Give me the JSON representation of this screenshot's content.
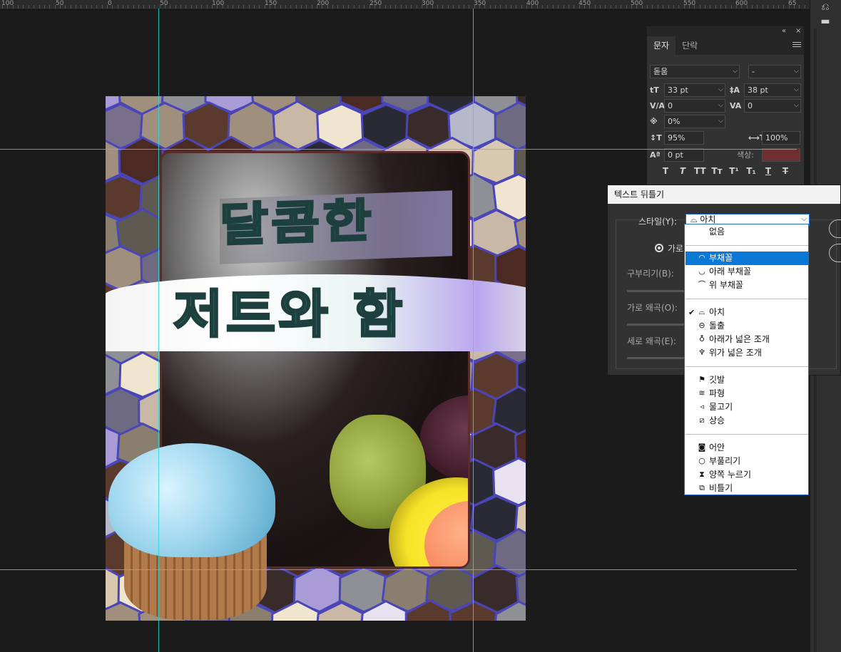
{
  "ruler": {
    "labels": [
      "100",
      "50",
      "0",
      "50",
      "100",
      "150",
      "200",
      "250",
      "300",
      "350",
      "400",
      "450",
      "500",
      "550",
      "600",
      "65"
    ]
  },
  "canvas": {
    "title_line1": "달콤한",
    "title_line2": "저트와 함"
  },
  "character_panel": {
    "tabs": [
      "문자",
      "단락"
    ],
    "collapse_icon": "«",
    "close_icon": "×",
    "font_family": "돋움",
    "font_style": "-",
    "font_size": "33 pt",
    "leading": "38 pt",
    "kerning": "0",
    "tracking": "0",
    "tsume": "0%",
    "vertical_scale": "95%",
    "horizontal_scale": "100%",
    "baseline_shift": "0 pt",
    "color_label": "색상:",
    "color_value": "#6d2f2f",
    "style_buttons": [
      "T",
      "T",
      "TT",
      "Tт",
      "T¹",
      "T₁",
      "T",
      "T"
    ]
  },
  "warp_dialog": {
    "title": "텍스트 뒤틀기",
    "style_label": "스타일(Y):",
    "style_value": "아치",
    "horizontal_label": "가로",
    "bend_label": "구부리기(B):",
    "horiz_distort_label": "가로 왜곡(O):",
    "vert_distort_label": "세로 왜곡(E):"
  },
  "style_menu": {
    "items": [
      {
        "label": "없음",
        "icon": "none"
      },
      {
        "label": "부채꼴",
        "icon": "arc-icon",
        "selected": true
      },
      {
        "label": "아래 부채꼴",
        "icon": "arc-lower-icon"
      },
      {
        "label": "위 부채꼴",
        "icon": "arc-upper-icon"
      },
      {
        "label": "아치",
        "icon": "arch-icon",
        "checked": true
      },
      {
        "label": "돌출",
        "icon": "bulge-icon"
      },
      {
        "label": "아래가 넓은 조개",
        "icon": "shell-lower-icon"
      },
      {
        "label": "위가 넓은 조개",
        "icon": "shell-upper-icon"
      },
      {
        "label": "깃발",
        "icon": "flag-icon"
      },
      {
        "label": "파형",
        "icon": "wave-icon"
      },
      {
        "label": "물고기",
        "icon": "fish-icon"
      },
      {
        "label": "상승",
        "icon": "rise-icon"
      },
      {
        "label": "어안",
        "icon": "fisheye-icon"
      },
      {
        "label": "부풀리기",
        "icon": "inflate-icon"
      },
      {
        "label": "양쪽 누르기",
        "icon": "squeeze-icon"
      },
      {
        "label": "비틀기",
        "icon": "twist-icon"
      }
    ]
  }
}
